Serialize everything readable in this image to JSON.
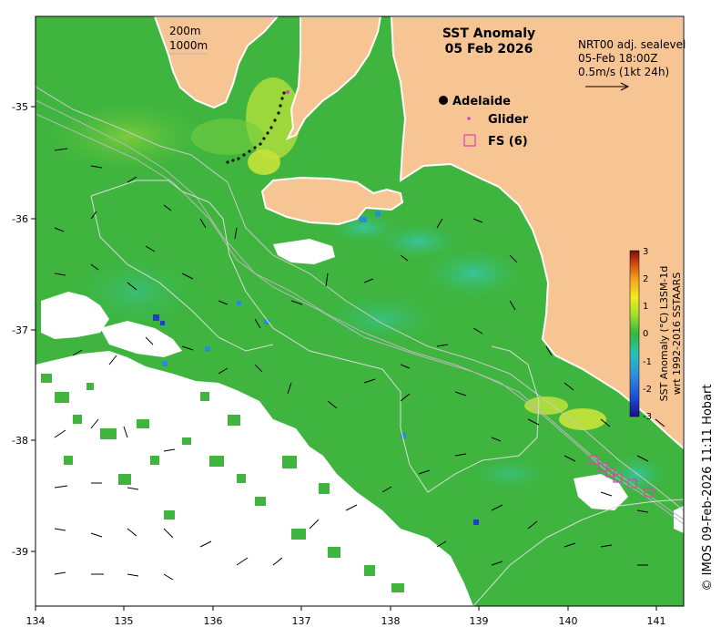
{
  "title": {
    "line1": "SST Anomaly",
    "line2": "05 Feb 2026"
  },
  "depth_legend": {
    "line1": "200m",
    "line2": "1000m"
  },
  "current_info": {
    "line1": "NRT00 adj. sealevel",
    "line2": "05-Feb 18:00Z",
    "line3": "0.5m/s (1kt 24h)"
  },
  "legend": {
    "adelaide": "Adelaide",
    "glider": "Glider",
    "fs": "FS (6)"
  },
  "colorbar": {
    "title_line1": "SST Anomaly (°C) L3SM-1d",
    "title_line2": "wrt 1992-2016 SSTAARS",
    "ticks": [
      "3",
      "2",
      "1",
      "0",
      "-1",
      "-2",
      "-3"
    ],
    "min": -3,
    "max": 3
  },
  "axes": {
    "x_ticks": [
      "134",
      "135",
      "136",
      "137",
      "138",
      "139",
      "140",
      "141"
    ],
    "y_ticks": [
      "-35",
      "-36",
      "-37",
      "-38",
      "-39"
    ],
    "lon_range": [
      134,
      141.3
    ],
    "lat_range": [
      -39.45,
      -34.2
    ]
  },
  "credit": "© IMOS 09-Feb-2026 11:11 Hobart",
  "colors": {
    "land": "#f7c493",
    "ocean_anomaly_zero": "#3fb53f",
    "no_data": "#ffffff",
    "glider": "#cc44cc",
    "fs_box": "#e040c0"
  }
}
